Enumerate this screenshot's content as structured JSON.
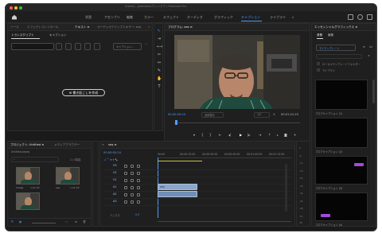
{
  "window": {
    "title": "/Users/.../premiere/ウィンドウ / Premiere Pro"
  },
  "menu": {
    "items": [
      {
        "label": "学習",
        "active": false
      },
      {
        "label": "アセンブリ",
        "active": false
      },
      {
        "label": "編集",
        "active": false
      },
      {
        "label": "カラー",
        "active": false
      },
      {
        "label": "エフェクト",
        "active": false
      },
      {
        "label": "オーディオ",
        "active": false
      },
      {
        "label": "グラフィック",
        "active": false
      },
      {
        "label": "キャプション",
        "active": true
      },
      {
        "label": "ライブラリ",
        "active": false
      }
    ],
    "more": "»"
  },
  "left_panel": {
    "tabs": [
      "ソース",
      "エフェクトコントロール",
      "テキスト ≡",
      "オーディオクリップミキサー: seq",
      "»"
    ],
    "subtabs": [
      "トランスクリプト",
      "キャプション"
    ],
    "search_placeholder": "",
    "import_button": "キャプション...",
    "transcribe_button": "書き起こしを作成"
  },
  "program_monitor": {
    "title": "プログラム: seq ≡",
    "timecode_current": "00:00:00:24",
    "fit": "全体表示",
    "quality": "1/2",
    "timecode_total": "00:01:21:23",
    "play_icon": "▶"
  },
  "project_panel": {
    "tabs": [
      "プロジェクト: Untitled ≡",
      "メディアブラウザー"
    ],
    "project_file": "Untitled.prproj",
    "item_count": "1 / 4項目",
    "thumbnails": [
      {
        "name": "Image",
        "duration": "1:21:23"
      },
      {
        "name": "seq",
        "duration": "1:21:23"
      },
      {
        "name": "",
        "duration": ""
      }
    ]
  },
  "timeline": {
    "title": "seq ≡",
    "timecode": "00:00:00:24",
    "ruler": [
      "00:00",
      "00:00:15:00",
      "00:00:30:00",
      "00:00:45:00",
      "00:01:00:00",
      "00:01:15:00"
    ],
    "tracks": [
      "V3",
      "V2",
      "V1",
      "A1",
      "A2",
      "A3"
    ],
    "mix_label": "ミックス",
    "mix_value": "0.0",
    "clip_label": "seq"
  },
  "essential_graphics": {
    "title": "エッセンシャルグラフィックス ≡",
    "tabs": [
      "参照",
      "編集"
    ],
    "dropdown": "マイテンプレート",
    "checkbox_local": "ローカルテンプレートフォルダー",
    "checkbox_adobe_fonts": "ライブラリ",
    "captions": [
      "フロアキャプション (1)",
      "フロアキャプション (2)",
      "フロアキャプション (3)",
      "フロアキャプション (4)"
    ]
  },
  "audio_meter": {
    "ticks": [
      "0",
      "-6",
      "-12",
      "-18",
      "-24",
      "-30",
      "-36",
      "-42",
      "-48",
      "-54"
    ],
    "db": "dB"
  },
  "colors": {
    "accent": "#4d9cff",
    "clip_video": "#8aa6c9",
    "caption_purple": "#a14cd8"
  }
}
